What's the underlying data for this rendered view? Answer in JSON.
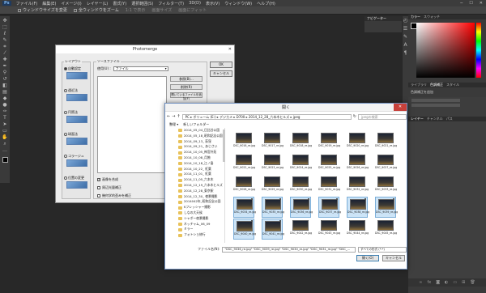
{
  "menubar": {
    "logo": "Ps",
    "items": [
      "ファイル(F)",
      "編集(E)",
      "イメージ(I)",
      "レイヤー(L)",
      "書式(Y)",
      "選択範囲(S)",
      "フィルター(T)",
      "3D(D)",
      "表示(V)",
      "ウィンドウ(W)",
      "ヘルプ(H)"
    ]
  },
  "optionsbar": {
    "items": [
      "ウィンドウサイズを変更",
      "全ウィンドウをズーム",
      "1:1 で表示",
      "画面サイズ",
      "画面にフィット"
    ]
  },
  "right_panel": {
    "color_tabs": [
      "カラー",
      "スウォッチ"
    ],
    "mid_tabs": [
      "ライブラリ",
      "色調補正",
      "スタイル"
    ],
    "mid_label": "色調補正を追加",
    "layer_tabs": [
      "レイヤー",
      "チャンネル",
      "パス"
    ]
  },
  "navigator": {
    "title": "ナビゲーター"
  },
  "photomerge": {
    "title": "Photomerge",
    "layout_label": "レイアウト",
    "layouts": [
      {
        "label": "自動設定",
        "selected": true
      },
      {
        "label": "遠近法",
        "selected": false
      },
      {
        "label": "円筒法",
        "selected": false
      },
      {
        "label": "球面法",
        "selected": false
      },
      {
        "label": "コラージュ",
        "selected": false
      },
      {
        "label": "位置の変更",
        "selected": false
      }
    ],
    "source_label": "ソースファイル",
    "use_label": "使用(U) :",
    "use_value": "ファイル",
    "browse_button": "参照(B)...",
    "remove_button": "削除(R)",
    "add_open_button": "開いているファイルを追加(F)",
    "opt_blend": "画像を合成",
    "opt_vignette": "周辺光量補正",
    "opt_distortion": "幾何学的歪みを補正",
    "ok": "OK",
    "cancel": "キャンセル"
  },
  "open_dialog": {
    "title": "開く",
    "path": "PC ▸ ボリューム (E:) ▸ デジカメ ▸ D700 ▸ 2014_12_28_六本木ヒルズ ▸ jpeg",
    "search_placeholder": "jpegの検索",
    "organize": "整理 ▾",
    "new_folder": "新しいフォルダー",
    "nav_items": [
      "2014_05_04_日比谷公園",
      "2014_05_18_昭和記念公園",
      "2014_09_13_ 荻窪",
      "2014_09_21_ あじさい",
      "2014_10_05_神宮外苑",
      "2014_10_08_月蝕",
      "2014_10_18_江ノ島",
      "2014_10_22_ 紅葉",
      "2014_11_01_ 紅葉",
      "2014_11_05_六本木",
      "2014_12_19_六本木ヒルズ",
      "2014_12_28_東京駅",
      "2014_12_30_ 夜景撮影",
      "2014042年_昭和記念公園",
      "Kフレッシャー撮影",
      "しなの大天候",
      "シャボー夜景撮影",
      "ネッチャム_06_09",
      "ミラー",
      "フォトショ修行"
    ],
    "files": [
      {
        "name": "DSC_9016_re.jpg",
        "sel": false
      },
      {
        "name": "DSC_9017_re.jpg",
        "sel": false
      },
      {
        "name": "DSC_9018_re.jpg",
        "sel": false
      },
      {
        "name": "DSC_9019_re.jpg",
        "sel": false
      },
      {
        "name": "DSC_9020_re.jpg",
        "sel": false
      },
      {
        "name": "DSC_9021_re.jpg",
        "sel": false
      },
      {
        "name": "DSC_9022_re.jpg",
        "sel": false
      },
      {
        "name": "DSC_9023_re.jpg",
        "sel": false
      },
      {
        "name": "DSC_9024_re.jpg",
        "sel": false
      },
      {
        "name": "DSC_9025_re.jpg",
        "sel": false
      },
      {
        "name": "DSC_9026_re.jpg",
        "sel": false
      },
      {
        "name": "DSC_9027_re.jpg",
        "sel": false
      },
      {
        "name": "DSC_9028_re.jpg",
        "sel": false
      },
      {
        "name": "DSC_9029_re.jpg",
        "sel": false
      },
      {
        "name": "DSC_9030_re.jpg",
        "sel": false
      },
      {
        "name": "DSC_9031_re.jpg",
        "sel": false
      },
      {
        "name": "DSC_9032_re.jpg",
        "sel": false
      },
      {
        "name": "DSC_9033_re.jpg",
        "sel": false
      },
      {
        "name": "DSC_9034_re.jpg",
        "sel": true
      },
      {
        "name": "DSC_9035_re.jpg",
        "sel": true
      },
      {
        "name": "DSC_9036_re.jpg",
        "sel": true
      },
      {
        "name": "DSC_9037_re.jpg",
        "sel": true
      },
      {
        "name": "DSC_9038_re.jpg",
        "sel": true
      },
      {
        "name": "DSC_9039_re.jpg",
        "sel": true
      },
      {
        "name": "DSC_9040_re.jpg",
        "sel": true
      },
      {
        "name": "DSC_9041_re.jpg",
        "sel": true
      },
      {
        "name": "DSC_9042_re.jpg",
        "sel": false
      },
      {
        "name": "DSC_9043_re.jpg",
        "sel": false
      },
      {
        "name": "DSC_9044_re.jpg",
        "sel": false
      },
      {
        "name": "DSC_9045_re.jpg",
        "sel": false
      }
    ],
    "filename_label": "ファイル名(N):",
    "filename_value": "\"DSC_9036_re.jpg\" \"DSC_9039_re.jpg\" \"DSC_9030_re.jpg\" \"DSC_9031_re.jpg\" \"DSC_...",
    "filetype": "すべての形式 (*.*)",
    "open_button": "開く(O)",
    "cancel_button": "キャンセル"
  }
}
